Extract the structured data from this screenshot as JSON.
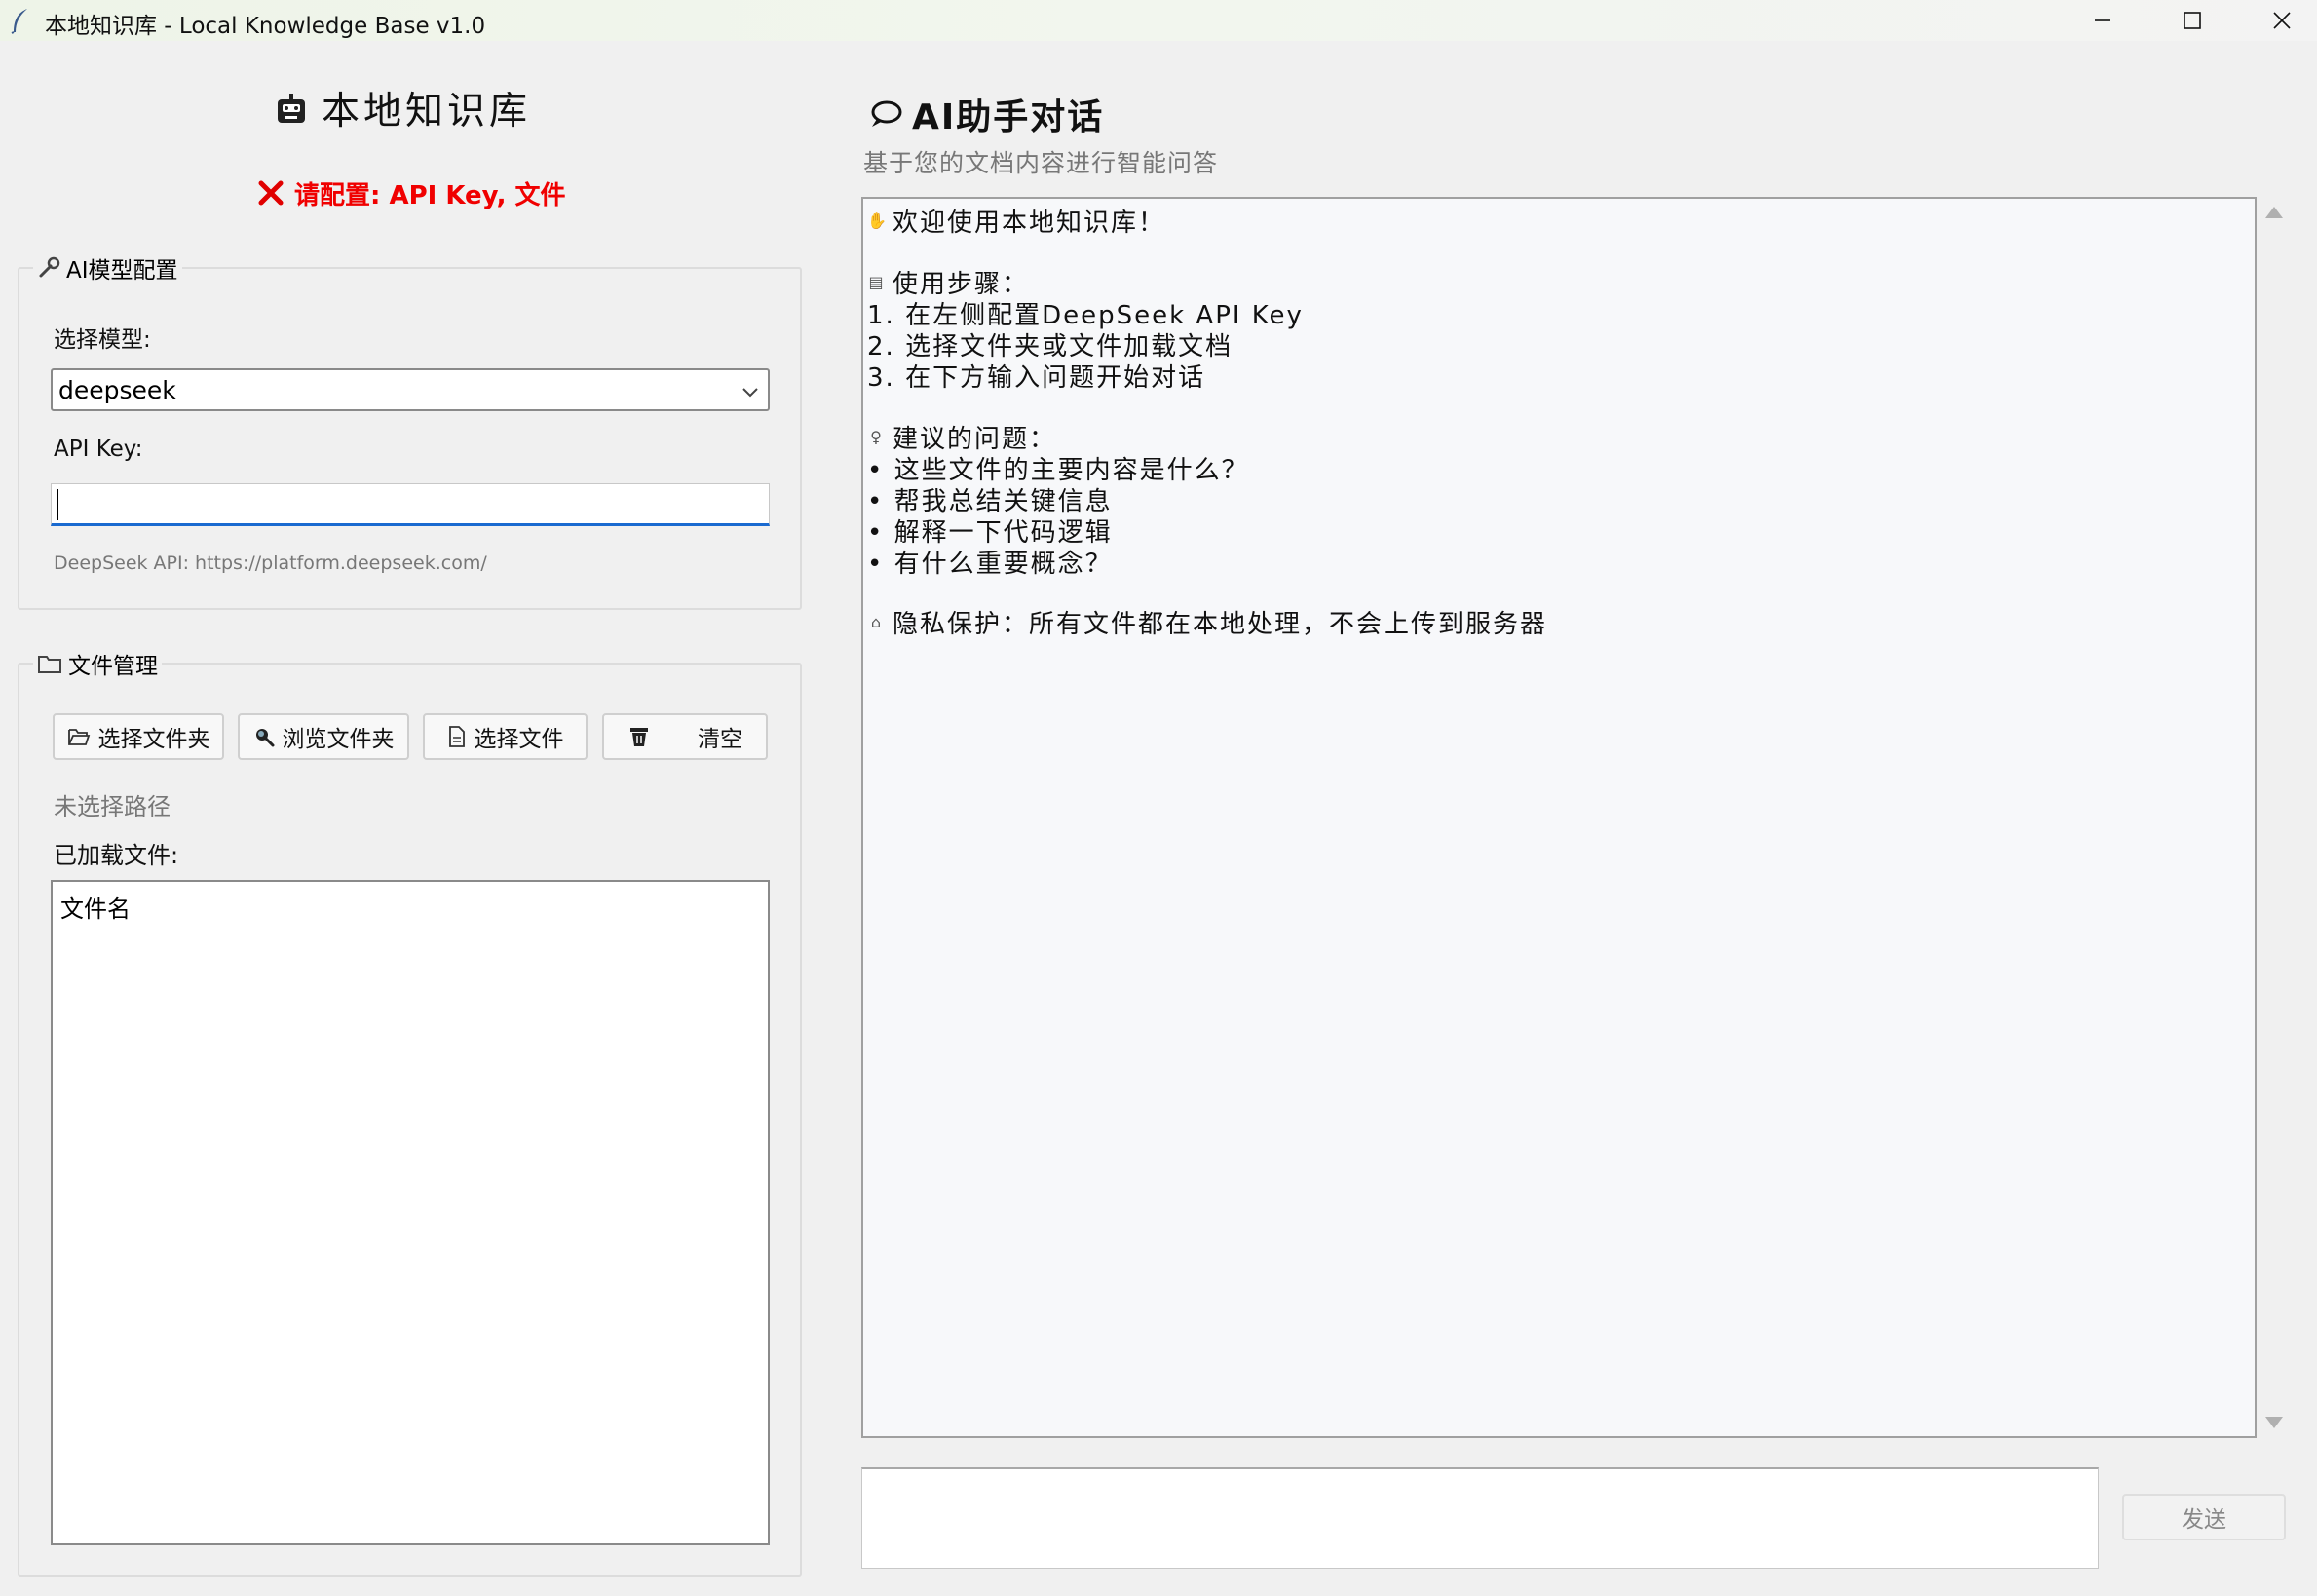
{
  "window": {
    "title": "本地知识库 - Local Knowledge Base v1.0",
    "controls": {
      "minimize": "minimize",
      "maximize": "maximize",
      "close": "close"
    }
  },
  "left": {
    "app_title": "本地知识库",
    "warning": "请配置: API Key, 文件",
    "model_group": {
      "legend": "AI模型配置",
      "model_label": "选择模型:",
      "model_value": "deepseek",
      "api_key_label": "API Key:",
      "api_key_value": "",
      "hint": "DeepSeek API: https://platform.deepseek.com/"
    },
    "file_group": {
      "legend": "文件管理",
      "buttons": {
        "select_folder": "选择文件夹",
        "browse_folder": "浏览文件夹",
        "select_file": "选择文件",
        "clear": "清空"
      },
      "path_status": "未选择路径",
      "loaded_label": "已加载文件:",
      "list_header": "文件名"
    }
  },
  "right": {
    "chat_title": "AI助手对话",
    "chat_subtitle": "基于您的文档内容进行智能问答",
    "messages": {
      "welcome": "欢迎使用本地知识库！",
      "steps_title": "使用步骤：",
      "step1": "1. 在左侧配置DeepSeek API Key",
      "step2": "2. 选择文件夹或文件加载文档",
      "step3": "3. 在下方输入问题开始对话",
      "suggest_title": "建议的问题：",
      "q1": "• 这些文件的主要内容是什么？",
      "q2": "• 帮我总结关键信息",
      "q3": "• 解释一下代码逻辑",
      "q4": "• 有什么重要概念？",
      "privacy": "隐私保护：所有文件都在本地处理，不会上传到服务器"
    },
    "send_label": "发送"
  },
  "colors": {
    "warning": "#f00000",
    "focus_border": "#1a6ad0",
    "muted_text": "#777777"
  },
  "icons": {
    "app": "feather-icon",
    "title": "robot-icon",
    "warning": "cross-mark-icon",
    "model_group": "wrench-icon",
    "file_group": "folder-icon",
    "select_folder": "open-folder-icon",
    "browse_folder": "magnifier-icon",
    "select_file": "file-icon",
    "clear": "trash-icon",
    "chat": "speech-bubble-icon"
  }
}
